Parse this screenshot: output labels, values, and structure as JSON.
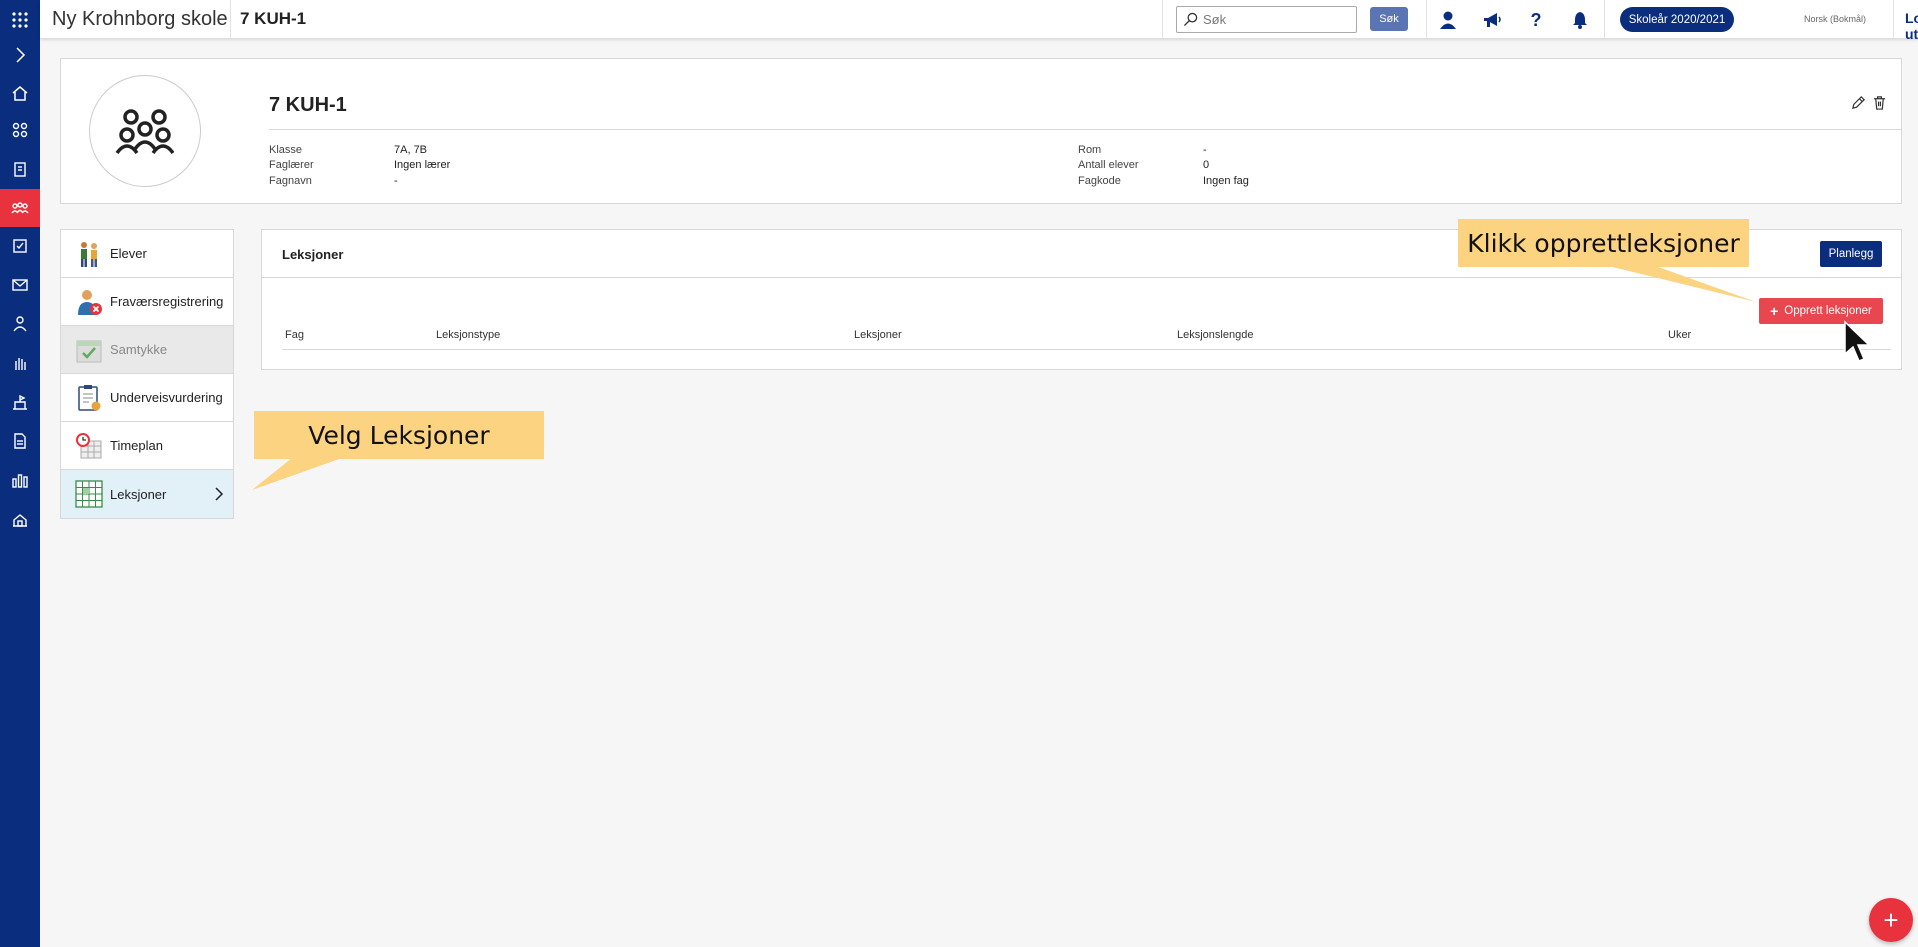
{
  "topbar": {
    "school_name": "Ny Krohnborg skole",
    "breadcrumb": "7 KUH-1",
    "search_placeholder": "Søk",
    "search_button": "Søk",
    "school_year": "Skoleår 2020/2021",
    "language": "Norsk (Bokmål)",
    "logout": "Logg ut"
  },
  "header": {
    "title": "7 KUH-1",
    "fields": {
      "klasse_label": "Klasse",
      "klasse_value": "7A, 7B",
      "faglaerer_label": "Faglærer",
      "faglaerer_value": "Ingen lærer",
      "fagnavn_label": "Fagnavn",
      "fagnavn_value": "-",
      "rom_label": "Rom",
      "rom_value": "-",
      "antall_label": "Antall elever",
      "antall_value": "0",
      "fagkode_label": "Fagkode",
      "fagkode_value": "Ingen fag"
    }
  },
  "menu": {
    "items": [
      {
        "label": "Elever"
      },
      {
        "label": "Fraværsregistrering"
      },
      {
        "label": "Samtykke"
      },
      {
        "label": "Underveisvurdering"
      },
      {
        "label": "Timeplan"
      },
      {
        "label": "Leksjoner"
      }
    ]
  },
  "panel": {
    "title": "Leksjoner",
    "plan_button": "Planlegg",
    "create_button": "Opprett leksjoner",
    "columns": [
      "Fag",
      "Leksjonstype",
      "Leksjoner",
      "Leksjonslengde",
      "Uker"
    ]
  },
  "annotations": {
    "create_hint": "Klikk opprettleksjoner",
    "select_hint": "Velg Leksjoner"
  },
  "fab": "+",
  "colors": {
    "primary": "#0a2d7d",
    "accent_red": "#e8333e",
    "callout": "#fcd381"
  }
}
